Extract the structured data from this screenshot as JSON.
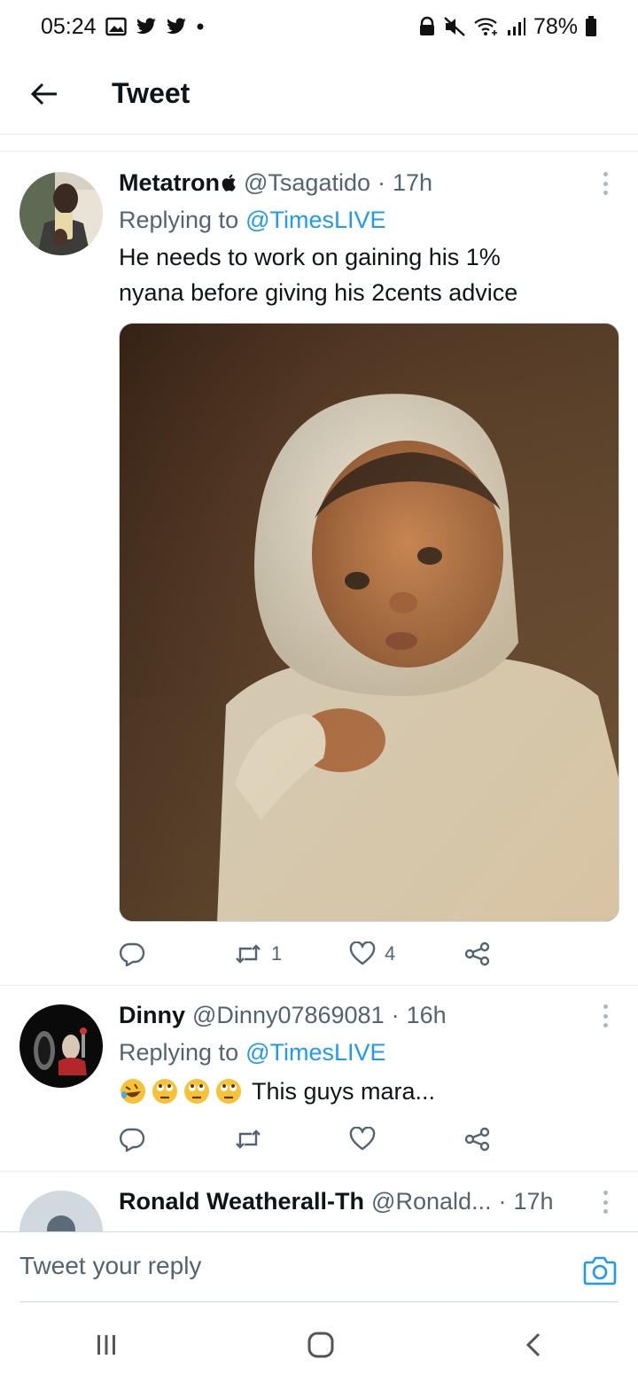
{
  "status_bar": {
    "time": "05:24",
    "battery": "78%"
  },
  "header": {
    "title": "Tweet"
  },
  "tweets": [
    {
      "name": "Metatron",
      "handle": "@Tsagatido",
      "time": "17h",
      "replying_prefix": "Replying to",
      "replying_to": "@TimesLIVE",
      "text_line1": "He needs to work on gaining his 1%",
      "text_line2": "nyana before giving his 2cents advice",
      "retweets": "1",
      "likes": "4"
    },
    {
      "name": "Dinny",
      "handle": "@Dinny07869081",
      "time": "16h",
      "replying_prefix": "Replying to",
      "replying_to": "@TimesLIVE",
      "text": "This guys mara...",
      "retweets": "",
      "likes": ""
    },
    {
      "name": "Ronald Weatherall-Th",
      "handle": "@Ronald...",
      "time": "17h"
    }
  ],
  "composer": {
    "placeholder": "Tweet your reply"
  },
  "colors": {
    "accent": "#1d9bf0",
    "muted": "#536471",
    "divider": "#e6ecf0"
  }
}
